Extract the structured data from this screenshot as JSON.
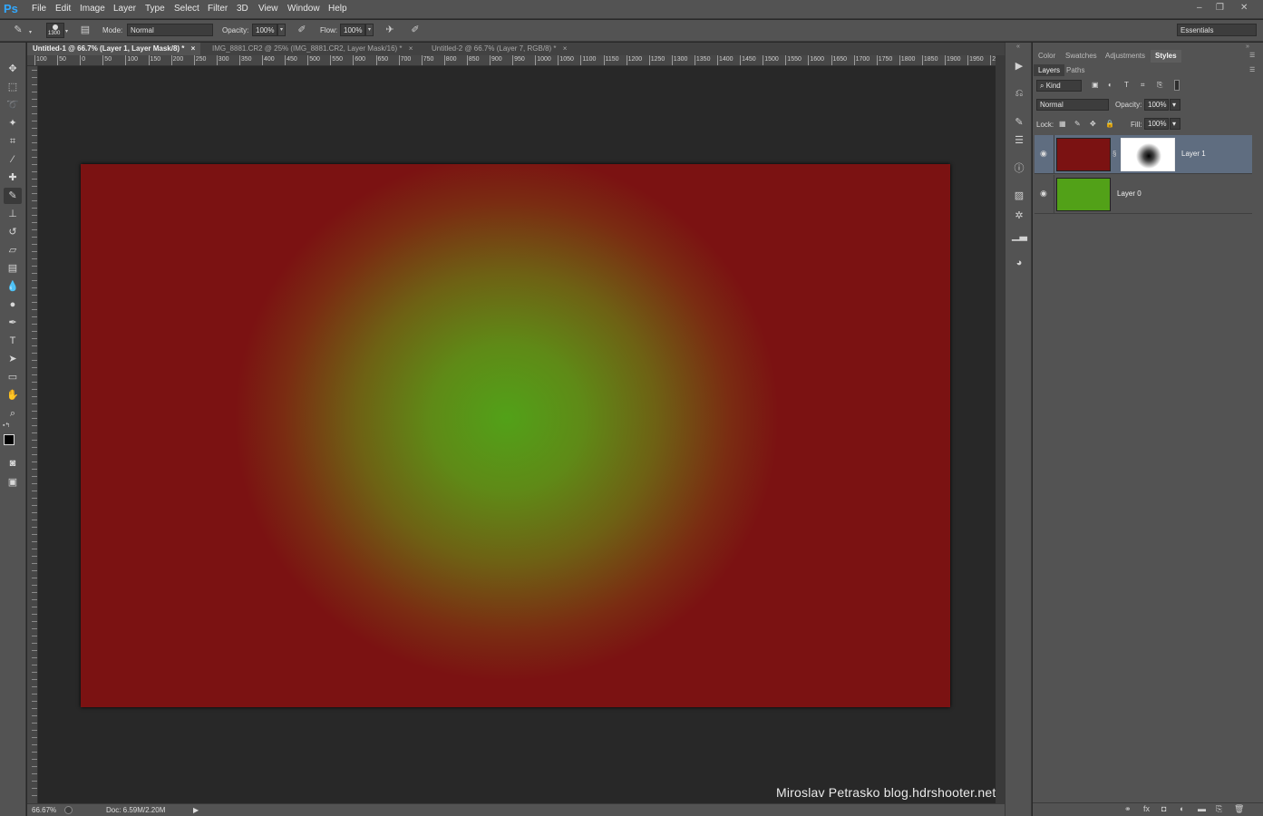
{
  "app": {
    "logo": "Ps"
  },
  "menu": [
    "File",
    "Edit",
    "Image",
    "Layer",
    "Type",
    "Select",
    "Filter",
    "3D",
    "View",
    "Window",
    "Help"
  ],
  "window_controls": {
    "minimize": "–",
    "restore": "❐",
    "close": "✕"
  },
  "options": {
    "brush_size": "1300",
    "mode_label": "Mode:",
    "mode_value": "Normal",
    "opacity_label": "Opacity:",
    "opacity_value": "100%",
    "flow_label": "Flow:",
    "flow_value": "100%",
    "workspace": "Essentials"
  },
  "tabs": [
    {
      "label": "Untitled-1 @ 66.7% (Layer 1, Layer Mask/8) *",
      "close": "×"
    },
    {
      "label": "IMG_8881.CR2 @ 25% (IMG_8881.CR2, Layer Mask/16) *",
      "close": "×"
    },
    {
      "label": "Untitled-2 @ 66.7% (Layer 7, RGB/8) *",
      "close": "×"
    }
  ],
  "ruler_labels": [
    "100",
    "50",
    "0",
    "50",
    "100",
    "150",
    "200",
    "250",
    "300",
    "350",
    "400",
    "450",
    "500",
    "550",
    "600",
    "650",
    "700",
    "750",
    "800",
    "850",
    "900",
    "950",
    "1000",
    "1050",
    "1100",
    "1150",
    "1200",
    "1250",
    "1300",
    "1350",
    "1400",
    "1450",
    "1500",
    "1550",
    "1600",
    "1650",
    "1700",
    "1750",
    "1800",
    "1850",
    "1900",
    "1950",
    "2"
  ],
  "watermark": "Miroslav  Petrasko  blog.hdrshooter.net",
  "status": {
    "zoom": "66.67%",
    "doc": "Doc: 6.59M/2.20M"
  },
  "panels": {
    "top_tabs": [
      "Color",
      "Swatches",
      "Adjustments",
      "Styles"
    ],
    "layer_tabs": [
      "Layers",
      "Paths"
    ],
    "filter_kind": "Kind",
    "blend_mode": "Normal",
    "opacity_label": "Opacity:",
    "opacity_value": "100%",
    "lock_label": "Lock:",
    "fill_label": "Fill:",
    "fill_value": "100%"
  },
  "layers": [
    {
      "name": "Layer 1",
      "color": "#7b1212",
      "has_mask": true
    },
    {
      "name": "Layer 0",
      "color": "#52a118",
      "has_mask": false
    }
  ],
  "colors": {
    "canvas_center": "#52a118",
    "canvas_edge": "#7b1212",
    "selected_layer": "#5f6d80"
  }
}
